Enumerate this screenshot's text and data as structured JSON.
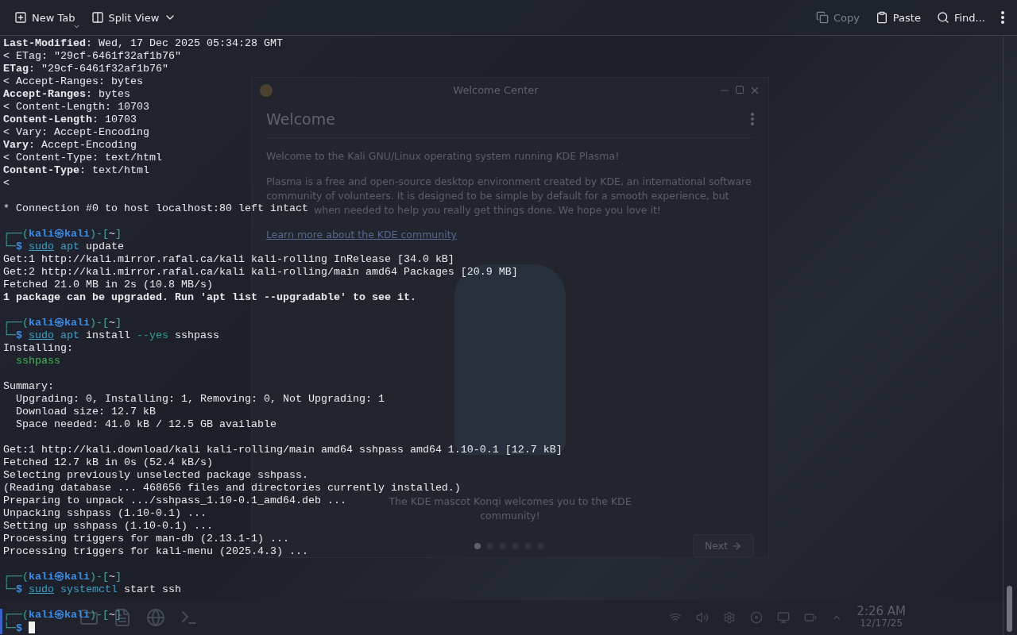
{
  "desktop": {
    "welcome_window": {
      "title": "Welcome Center",
      "heading": "Welcome",
      "intro": "Welcome to the Kali GNU/Linux operating system running KDE Plasma!",
      "body": [
        {
          "kind": "full",
          "text": "Plasma is a free and open-source desktop environment created by KDE, an international software"
        },
        {
          "kind": "full",
          "text": "community of volunteers. It is designed to be simple by default for a smooth experience, but"
        },
        {
          "kind": "partial",
          "text": "when needed to help you really get things done. We hope you love it!"
        }
      ],
      "link": "Learn more about the KDE community",
      "caption": "The KDE mascot Konqi welcomes you to the KDE community!",
      "pages": [
        {
          "selected": true
        },
        {
          "selected": false
        },
        {
          "selected": false
        },
        {
          "selected": false
        },
        {
          "selected": false
        },
        {
          "selected": false
        }
      ],
      "next_button": "Next"
    },
    "taskbar": {
      "time": "2:26 AM",
      "date": "12/17/25"
    }
  },
  "toolbar": {
    "left": [
      {
        "label": "New Tab",
        "menu": true,
        "disabled": false
      },
      {
        "label": "Split View",
        "menu": true,
        "disabled": false
      }
    ],
    "right": [
      {
        "label": "Copy",
        "menu": false,
        "disabled": true
      },
      {
        "label": "Paste",
        "menu": false,
        "disabled": false
      },
      {
        "label": "Find...",
        "menu": false,
        "disabled": false
      }
    ]
  },
  "terminal": {
    "lines": [
      {
        "kind": "text",
        "text": "**Last-Modified**: Wed, 17 Dec 2025 05:34:28 GMT"
      },
      {
        "kind": "text",
        "text": "< ETag: \"29cf-6461f32af1b76\""
      },
      {
        "kind": "text",
        "text": "**ETag**: \"29cf-6461f32af1b76\""
      },
      {
        "kind": "text",
        "text": "< Accept-Ranges: bytes"
      },
      {
        "kind": "text",
        "text": "**Accept-Ranges**: bytes"
      },
      {
        "kind": "text",
        "text": "< Content-Length: 10703"
      },
      {
        "kind": "text",
        "text": "**Content-Length**: 10703"
      },
      {
        "kind": "text",
        "text": "< Vary: Accept-Encoding"
      },
      {
        "kind": "text",
        "text": "**Vary**: Accept-Encoding"
      },
      {
        "kind": "text",
        "text": "< Content-Type: text/html"
      },
      {
        "kind": "text",
        "text": "**Content-Type**: text/html"
      },
      {
        "kind": "text",
        "text": "<"
      },
      {
        "kind": "blank"
      },
      {
        "kind": "text",
        "text": "* Connection #0 to host localhost:80 left intact"
      },
      {
        "kind": "blank"
      },
      {
        "kind": "prompt",
        "open": "┌──(",
        "user": "kali",
        "at": "㉿",
        "host": "kali",
        "close": ")-[",
        "dir": "~",
        "end": "]",
        "marker": false
      },
      {
        "kind": "command",
        "lead": "└─",
        "sign": "$",
        "tokens": [
          {
            "kind": "sudo",
            "text": "sudo"
          },
          {
            "kind": "program",
            "text": "apt"
          },
          {
            "kind": "plain",
            "text": "update"
          }
        ],
        "cursor": false,
        "marker": false
      },
      {
        "kind": "text",
        "text": "Get:1 http://kali.mirror.rafal.ca/kali kali-rolling InRelease [34.0 kB]"
      },
      {
        "kind": "text",
        "text": "Get:2 http://kali.mirror.rafal.ca/kali kali-rolling/main amd64 Packages [20.9 MB]"
      },
      {
        "kind": "text",
        "text": "Fetched 21.0 MB in 2s (10.8 MB/s)"
      },
      {
        "kind": "bold",
        "text": "1 package can be upgraded. Run 'apt list --upgradable' to see it."
      },
      {
        "kind": "blank"
      },
      {
        "kind": "prompt",
        "open": "┌──(",
        "user": "kali",
        "at": "㉿",
        "host": "kali",
        "close": ")-[",
        "dir": "~",
        "end": "]",
        "marker": false
      },
      {
        "kind": "command",
        "lead": "└─",
        "sign": "$",
        "tokens": [
          {
            "kind": "sudo",
            "text": "sudo"
          },
          {
            "kind": "program",
            "text": "apt"
          },
          {
            "kind": "plain",
            "text": "install"
          },
          {
            "kind": "option",
            "text": "--yes"
          },
          {
            "kind": "plain",
            "text": "sshpass"
          }
        ],
        "cursor": false,
        "marker": false
      },
      {
        "kind": "text",
        "text": "Installing:"
      },
      {
        "kind": "package",
        "text": "  sshpass"
      },
      {
        "kind": "blank"
      },
      {
        "kind": "text",
        "text": "Summary:"
      },
      {
        "kind": "text",
        "text": "  Upgrading: 0, Installing: 1, Removing: 0, Not Upgrading: 1"
      },
      {
        "kind": "text",
        "text": "  Download size: 12.7 kB"
      },
      {
        "kind": "text",
        "text": "  Space needed: 41.0 kB / 12.5 GB available"
      },
      {
        "kind": "blank"
      },
      {
        "kind": "text",
        "text": "Get:1 http://kali.download/kali kali-rolling/main amd64 sshpass amd64 1.10-0.1 [12.7 kB]"
      },
      {
        "kind": "text",
        "text": "Fetched 12.7 kB in 0s (52.4 kB/s)"
      },
      {
        "kind": "text",
        "text": "Selecting previously unselected package sshpass."
      },
      {
        "kind": "text",
        "text": "(Reading database ... 468656 files and directories currently installed.)"
      },
      {
        "kind": "text",
        "text": "Preparing to unpack .../sshpass_1.10-0.1_amd64.deb ..."
      },
      {
        "kind": "text",
        "text": "Unpacking sshpass (1.10-0.1) ..."
      },
      {
        "kind": "text",
        "text": "Setting up sshpass (1.10-0.1) ..."
      },
      {
        "kind": "text",
        "text": "Processing triggers for man-db (2.13.1-1) ..."
      },
      {
        "kind": "text",
        "text": "Processing triggers for kali-menu (2025.4.3) ..."
      },
      {
        "kind": "blank"
      },
      {
        "kind": "prompt",
        "open": "┌──(",
        "user": "kali",
        "at": "㉿",
        "host": "kali",
        "close": ")-[",
        "dir": "~",
        "end": "]",
        "marker": false
      },
      {
        "kind": "command",
        "lead": "└─",
        "sign": "$",
        "tokens": [
          {
            "kind": "sudo",
            "text": "sudo"
          },
          {
            "kind": "program",
            "text": "systemctl"
          },
          {
            "kind": "plain",
            "text": "start ssh"
          }
        ],
        "cursor": false,
        "marker": false
      },
      {
        "kind": "blank"
      },
      {
        "kind": "prompt",
        "open": "┌──(",
        "user": "kali",
        "at": "㉿",
        "host": "kali",
        "close": ")-[",
        "dir": "~",
        "end": "]",
        "marker": true
      },
      {
        "kind": "command",
        "lead": "└─",
        "sign": "$",
        "cursor": true,
        "marker": true
      }
    ]
  }
}
